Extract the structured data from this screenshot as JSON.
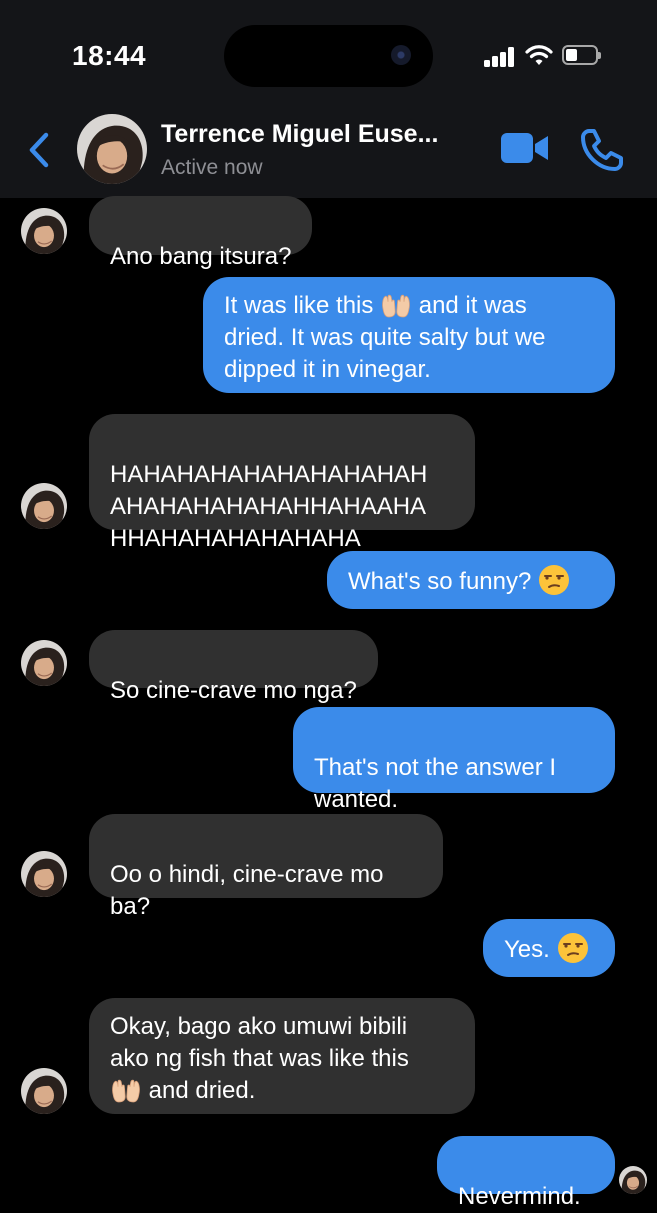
{
  "status_bar": {
    "time": "18:44"
  },
  "header": {
    "contact_name": "Terrence Miguel Euse...",
    "status": "Active now"
  },
  "messages": [
    {
      "side": "in",
      "text": "Ano bang itsura?"
    },
    {
      "side": "out",
      "text_a": "It was like this ",
      "emoji": "hands-icon",
      "text_b": " and it was\ndried. It was quite salty but we\ndipped it in vinegar."
    },
    {
      "side": "in",
      "text": "HAHAHAHAHAHAHAHAHAH\nAHAHAHAHAHAHHAHAAHA\nHHAHAHAHAHAHAHA"
    },
    {
      "side": "out",
      "text": "What's so funny? ",
      "emoji": "unamused-face-icon"
    },
    {
      "side": "in",
      "text": "So cine-crave mo nga?"
    },
    {
      "side": "out",
      "text": "That's not the answer I\nwanted."
    },
    {
      "side": "in",
      "text": "Oo o hindi, cine-crave mo\nba?"
    },
    {
      "side": "out",
      "text": "Yes. ",
      "emoji": "unamused-face-icon"
    },
    {
      "side": "in",
      "text_a": "Okay, bago ako umuwi bibili\nako ng fish that was like this\n",
      "emoji": "hands-icon",
      "text_b": " and dried."
    },
    {
      "side": "out",
      "text": "Nevermind."
    }
  ],
  "colors": {
    "incoming_bubble": "#303030",
    "outgoing_bubble": "#3b8bea",
    "accent": "#3b8bea",
    "header_bg": "#141518"
  }
}
